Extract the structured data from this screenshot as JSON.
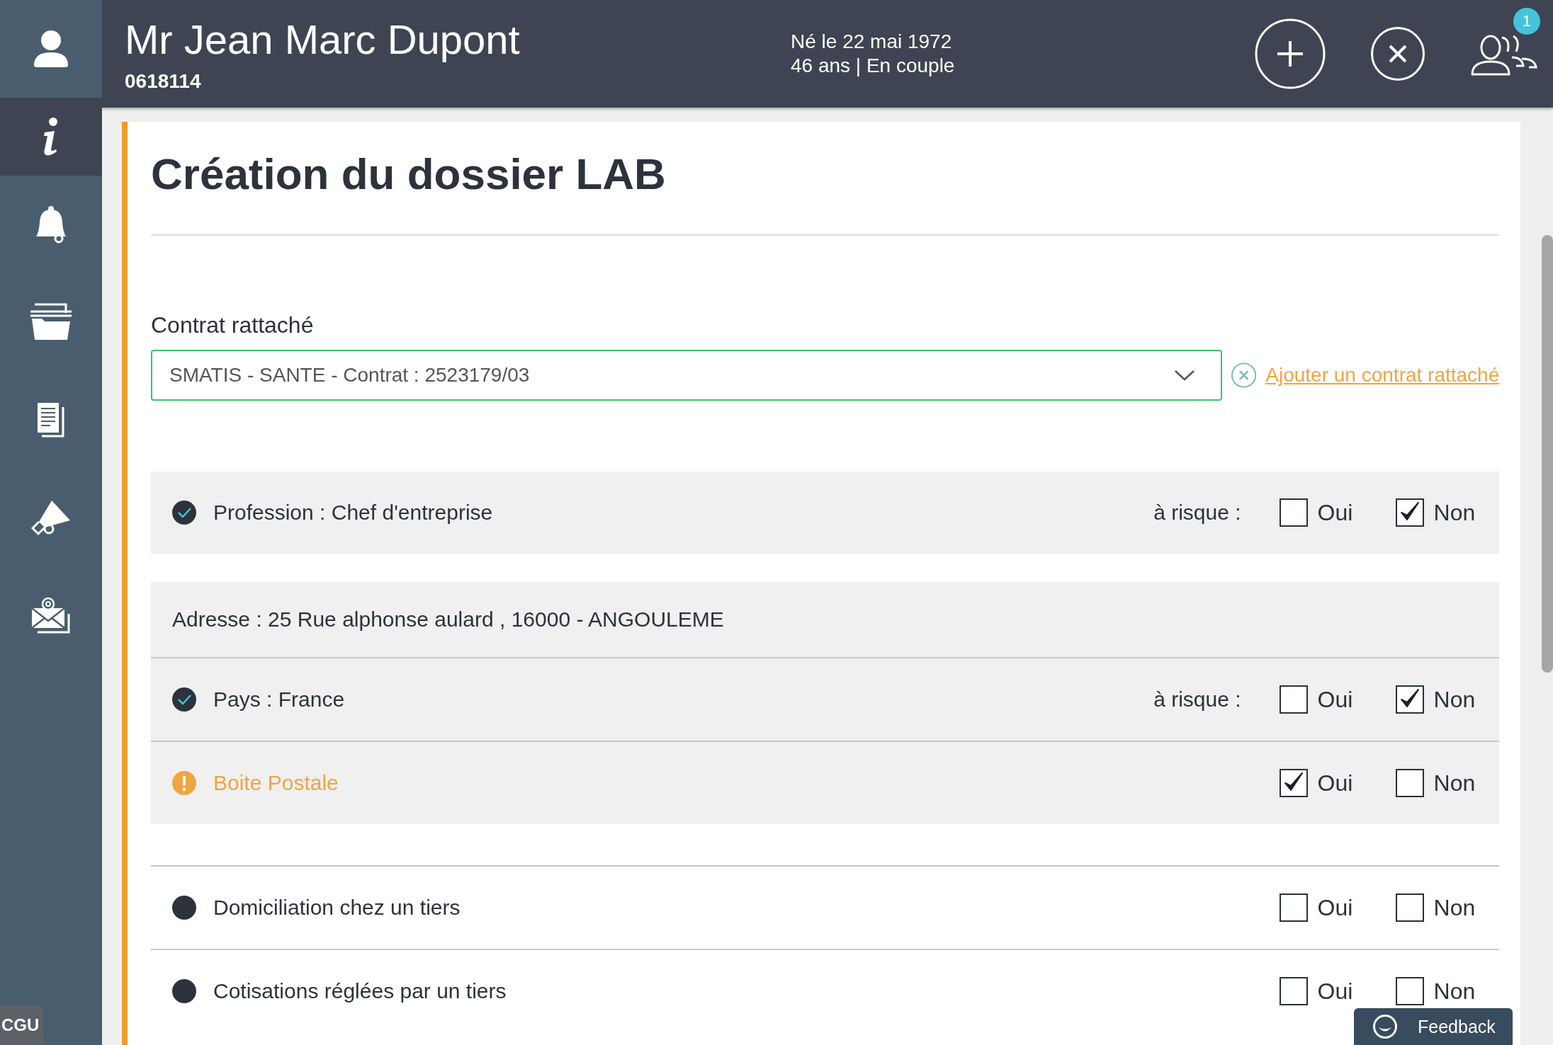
{
  "header": {
    "name": "Mr Jean Marc Dupont",
    "id_number": "0618114",
    "birth": "Né le 22 mai 1972",
    "details": "46 ans | En couple",
    "notification_count": "1"
  },
  "sidebar": {
    "items": [
      {
        "selected": false
      },
      {
        "selected": true
      },
      {
        "selected": false
      },
      {
        "selected": false
      },
      {
        "selected": false
      },
      {
        "selected": false
      },
      {
        "selected": false
      }
    ],
    "footer_tab": "CGU"
  },
  "form": {
    "title": "Création du dossier LAB",
    "contract_label": "Contrat rattaché",
    "contract_value": "SMATIS - SANTE - Contrat : 2523179/03",
    "add_contract_link": "Ajouter un contrat rattaché",
    "groups": [
      {
        "shaded": true,
        "rows": [
          {
            "kind": "ok",
            "label": "Profession : Chef d'entreprise",
            "risk_label": "à risque :",
            "options": [
              {
                "label": "Oui",
                "checked": false
              },
              {
                "label": "Non",
                "checked": true
              }
            ]
          }
        ]
      },
      {
        "shaded": true,
        "rows": [
          {
            "kind": "info",
            "label": "Adresse : 25 Rue alphonse aulard , 16000 - ANGOULEME"
          },
          {
            "kind": "ok",
            "label": "Pays : France",
            "risk_label": "à risque :",
            "options": [
              {
                "label": "Oui",
                "checked": false
              },
              {
                "label": "Non",
                "checked": true
              }
            ]
          },
          {
            "kind": "warning",
            "label": "Boite Postale",
            "options": [
              {
                "label": "Oui",
                "checked": true
              },
              {
                "label": "Non",
                "checked": false
              }
            ]
          }
        ]
      },
      {
        "shaded": false,
        "rows": [
          {
            "kind": "pending",
            "label": "Domiciliation chez un tiers",
            "options": [
              {
                "label": "Oui",
                "checked": false
              },
              {
                "label": "Non",
                "checked": false
              }
            ]
          },
          {
            "kind": "pending",
            "label": "Cotisations réglées par un tiers",
            "options": [
              {
                "label": "Oui",
                "checked": false
              },
              {
                "label": "Non",
                "checked": false
              }
            ]
          }
        ]
      }
    ]
  },
  "feedback_button": "Feedback"
}
